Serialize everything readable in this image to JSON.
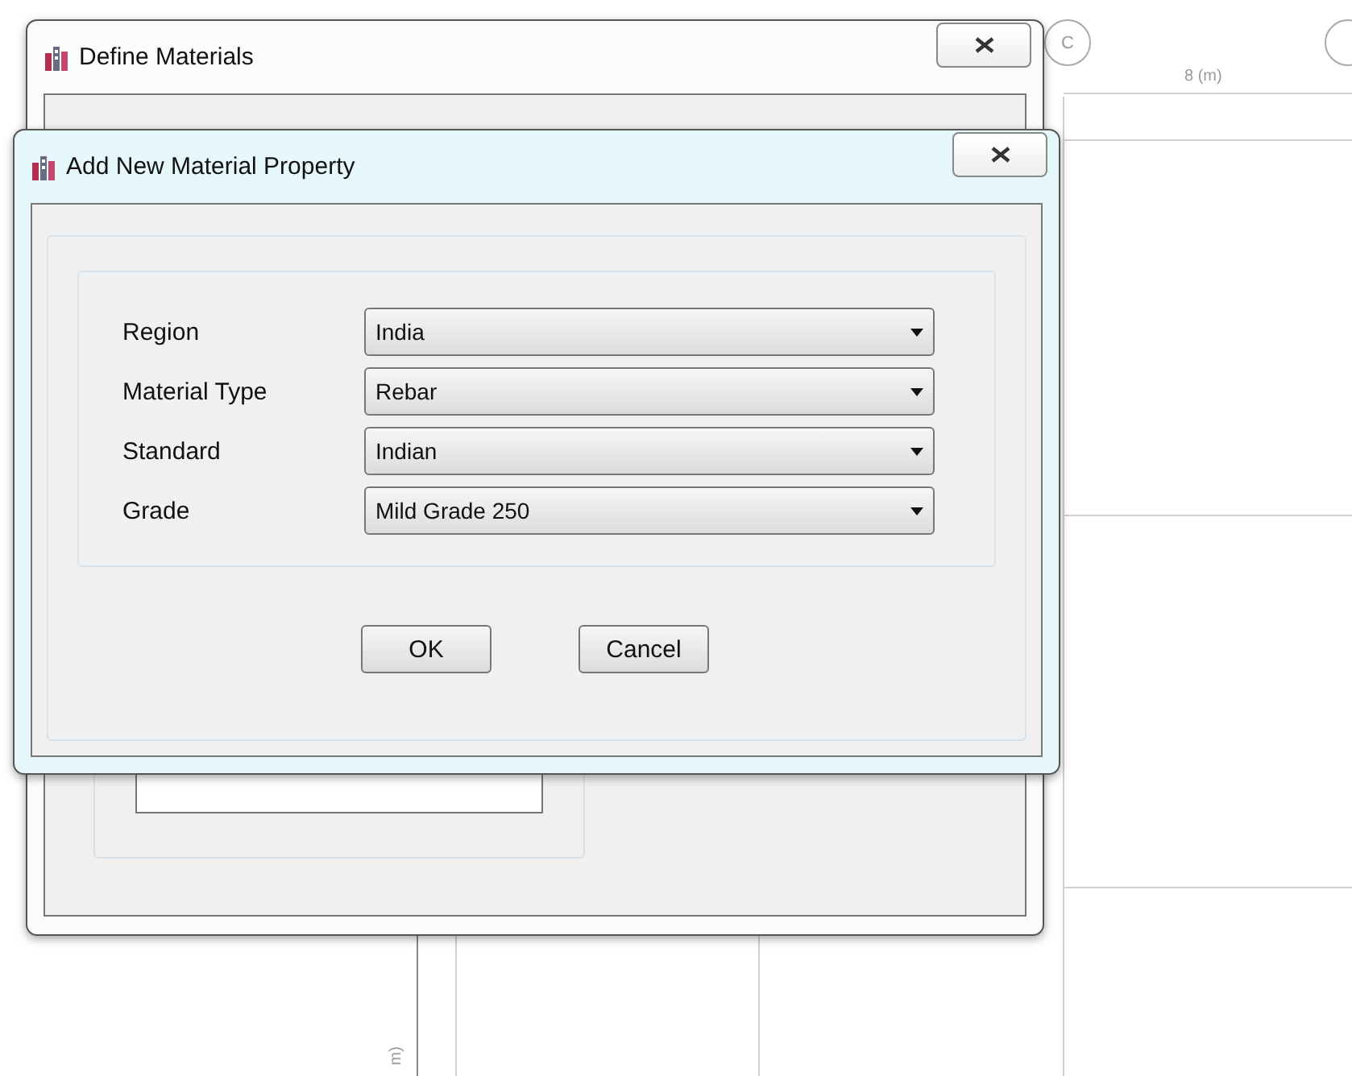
{
  "canvas": {
    "grid_bubble": "C",
    "dimension_label": "8 (m)",
    "axis_label": "m)"
  },
  "back_window": {
    "title": "Define Materials"
  },
  "dialog": {
    "title": "Add New Material Property",
    "fields": [
      {
        "label": "Region",
        "value": "India"
      },
      {
        "label": "Material Type",
        "value": "Rebar"
      },
      {
        "label": "Standard",
        "value": "Indian"
      },
      {
        "label": "Grade",
        "value": "Mild Grade 250"
      }
    ],
    "buttons": [
      "OK",
      "Cancel"
    ]
  }
}
